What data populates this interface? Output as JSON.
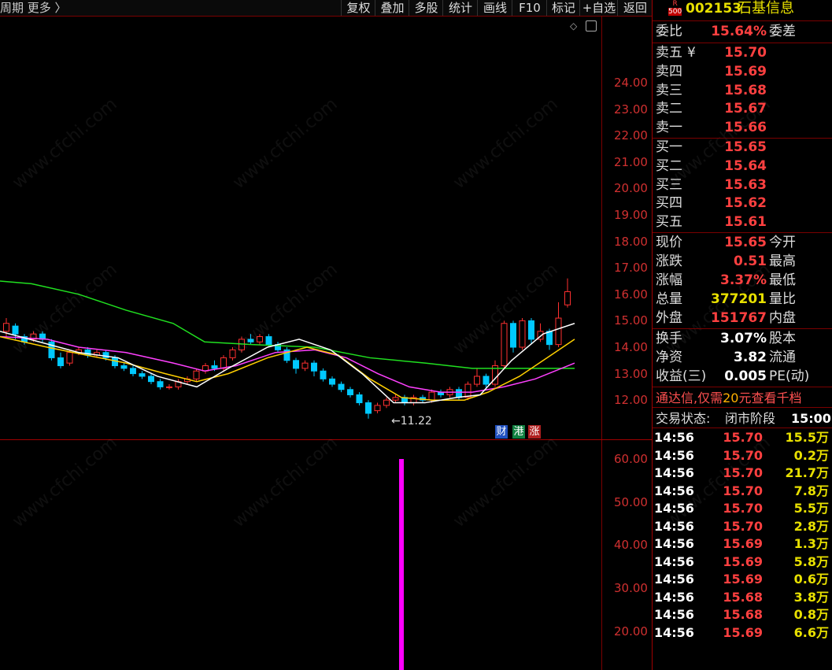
{
  "toolbar": {
    "left_text": "周期  更多 〉",
    "buttons": [
      "复权",
      "叠加",
      "多股",
      "统计",
      "画线",
      "F10",
      "标记",
      "+自选",
      "返回"
    ]
  },
  "chart": {
    "price_ticks": [
      "24.00",
      "23.00",
      "22.00",
      "21.00",
      "20.00",
      "19.00",
      "18.00",
      "17.00",
      "16.00",
      "15.00",
      "14.00",
      "13.00",
      "12.00"
    ],
    "volume_ticks": [
      "60.00",
      "50.00",
      "40.00",
      "30.00",
      "20.00"
    ],
    "low_marker": "11.22",
    "tags": [
      "财",
      "港",
      "涨"
    ],
    "colors": {
      "up": "#ff3030",
      "down": "#00c8ff",
      "ma5": "#ffffff",
      "ma10": "#ffd000",
      "ma20": "#ff40ff",
      "ma60": "#20e020",
      "volume_bar": "#ff00ff"
    }
  },
  "quote": {
    "badge_top": "R",
    "badge_bottom": "500",
    "code": "002153",
    "name": "石基信息",
    "weibi_label": "委比",
    "weibi_value": "15.64%",
    "weicha_label": "委差",
    "asks": [
      {
        "label": "卖五",
        "value": "15.70",
        "extra": "¥"
      },
      {
        "label": "卖四",
        "value": "15.69"
      },
      {
        "label": "卖三",
        "value": "15.68"
      },
      {
        "label": "卖二",
        "value": "15.67"
      },
      {
        "label": "卖一",
        "value": "15.66"
      }
    ],
    "bids": [
      {
        "label": "买一",
        "value": "15.65"
      },
      {
        "label": "买二",
        "value": "15.64"
      },
      {
        "label": "买三",
        "value": "15.63"
      },
      {
        "label": "买四",
        "value": "15.62"
      },
      {
        "label": "买五",
        "value": "15.61"
      }
    ],
    "stats": [
      {
        "label": "现价",
        "value": "15.65",
        "right": "今开"
      },
      {
        "label": "涨跌",
        "value": "0.51",
        "right": "最高"
      },
      {
        "label": "涨幅",
        "value": "3.37%",
        "right": "最低"
      },
      {
        "label": "总量",
        "value": "377201",
        "right": "量比"
      },
      {
        "label": "外盘",
        "value": "151767",
        "right": "内盘"
      }
    ],
    "stats2": [
      {
        "label": "换手",
        "value": "3.07%",
        "right": "股本"
      },
      {
        "label": "净资",
        "value": "3.82",
        "right": "流通"
      },
      {
        "label": "收益(三)",
        "value": "0.005",
        "right": "PE(动)"
      }
    ],
    "ad_text_a": "通达信,仅需",
    "ad_text_b": "20",
    "ad_text_c": "元查看千档",
    "status_label": "交易状态:",
    "status_value": "闭市阶段",
    "status_time": "15:00:",
    "ticks": [
      {
        "time": "14:56",
        "price": "15.70",
        "vol": "15.5万"
      },
      {
        "time": "14:56",
        "price": "15.70",
        "vol": "0.2万"
      },
      {
        "time": "14:56",
        "price": "15.70",
        "vol": "21.7万"
      },
      {
        "time": "14:56",
        "price": "15.70",
        "vol": "7.8万"
      },
      {
        "time": "14:56",
        "price": "15.70",
        "vol": "5.5万"
      },
      {
        "time": "14:56",
        "price": "15.70",
        "vol": "2.8万"
      },
      {
        "time": "14:56",
        "price": "15.69",
        "vol": "1.3万"
      },
      {
        "time": "14:56",
        "price": "15.69",
        "vol": "5.8万"
      },
      {
        "time": "14:56",
        "price": "15.69",
        "vol": "0.6万"
      },
      {
        "time": "14:56",
        "price": "15.68",
        "vol": "3.8万"
      },
      {
        "time": "14:56",
        "price": "15.68",
        "vol": "0.8万"
      },
      {
        "time": "14:56",
        "price": "15.69",
        "vol": "6.6万"
      }
    ]
  },
  "watermark": "www.cfchi.com"
}
